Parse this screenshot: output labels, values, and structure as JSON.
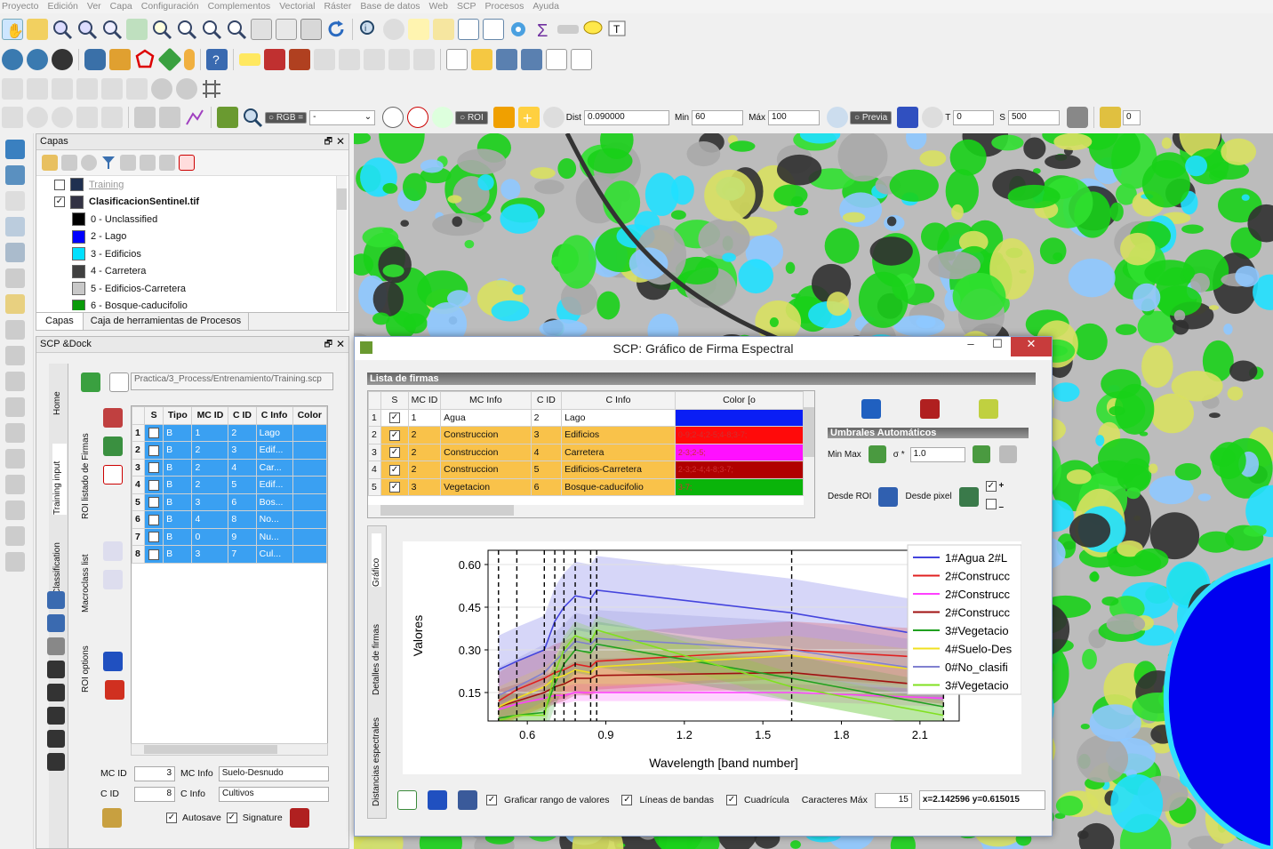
{
  "menu": [
    "Proyecto",
    "Edición",
    "Ver",
    "Capa",
    "Configuración",
    "Complementos",
    "Vectorial",
    "Ráster",
    "Base de datos",
    "Web",
    "SCP",
    "Procesos",
    "Ayuda"
  ],
  "scp_toolbar": {
    "rgb_label": "RGB =",
    "rgb_value": "-",
    "roi_label": "ROI",
    "dist_label": "Dist",
    "dist_value": "0.090000",
    "min_label": "Min",
    "min_value": "60",
    "max_label": "Máx",
    "max_value": "100",
    "previa_label": "Previa",
    "t_label": "T",
    "t_value": "0",
    "s_label": "S",
    "s_value": "500",
    "last_value": "0"
  },
  "layers_panel": {
    "title": "Capas",
    "tabs": [
      "Capas",
      "Caja de herramientas de Procesos"
    ],
    "items": [
      {
        "name": "Training",
        "color": "#203050",
        "indent": 0,
        "grey": true
      },
      {
        "name": "ClasificacionSentinel.tif",
        "color": "#334",
        "indent": 0,
        "bold": true
      },
      {
        "name": "0 - Unclassified",
        "color": "#000000"
      },
      {
        "name": "2 - Lago",
        "color": "#0000ff"
      },
      {
        "name": "3 - Edificios",
        "color": "#00e0ff"
      },
      {
        "name": "4 - Carretera",
        "color": "#404040"
      },
      {
        "name": "5 - Edificios-Carretera",
        "color": "#c8c8c8"
      },
      {
        "name": "6 - Bosque-caducifolio",
        "color": "#0a9a0a"
      }
    ]
  },
  "scp_dock": {
    "title": "SCP &Dock",
    "path": "Practica/3_Process/Entrenamiento/Training.scp",
    "vtabs": [
      "Home",
      "Training input",
      "Classification"
    ],
    "subtabs": [
      "ROI listado de Firmas",
      "Macroclass list",
      "ROI options"
    ],
    "roi_headers": [
      "S",
      "Tipo",
      "MC ID",
      "C ID",
      "C Info",
      "Color"
    ],
    "roi_rows": [
      [
        "1",
        "B",
        "1",
        "2",
        "Lago"
      ],
      [
        "2",
        "B",
        "2",
        "3",
        "Edif..."
      ],
      [
        "3",
        "B",
        "2",
        "4",
        "Car..."
      ],
      [
        "4",
        "B",
        "2",
        "5",
        "Edif..."
      ],
      [
        "5",
        "B",
        "3",
        "6",
        "Bos..."
      ],
      [
        "6",
        "B",
        "4",
        "8",
        "No..."
      ],
      [
        "7",
        "B",
        "0",
        "9",
        "Nu..."
      ],
      [
        "8",
        "B",
        "3",
        "7",
        "Cul..."
      ]
    ],
    "mc_id_label": "MC ID",
    "mc_id": "3",
    "mc_info_label": "MC Info",
    "mc_info": "Suelo-Desnudo",
    "c_id_label": "C ID",
    "c_id": "8",
    "c_info_label": "C Info",
    "c_info": "Cultivos",
    "autosave": "Autosave",
    "signature": "Signature"
  },
  "dialog": {
    "title": "SCP: Gráfico de Firma Espectral",
    "list_title": "Lista de firmas",
    "headers": [
      "S",
      "MC ID",
      "MC Info",
      "C ID",
      "C Info",
      "Color [o"
    ],
    "rows": [
      {
        "n": "1",
        "mcid": "1",
        "mcinfo": "Agua",
        "cid": "2",
        "cinfo": "Lago",
        "color": "#0a1ef5",
        "ctext": "",
        "orange": false
      },
      {
        "n": "2",
        "mcid": "2",
        "mcinfo": "Construccion",
        "cid": "3",
        "cinfo": "Edificios",
        "color": "#ff0a0a",
        "ctext": "0-9;2-4;2-5;4-8;3-7;",
        "orange": true
      },
      {
        "n": "3",
        "mcid": "2",
        "mcinfo": "Construccion",
        "cid": "4",
        "cinfo": "Carretera",
        "color": "#ff10ff",
        "ctext": "2-3;2-5;",
        "orange": true
      },
      {
        "n": "4",
        "mcid": "2",
        "mcinfo": "Construccion",
        "cid": "5",
        "cinfo": "Edificios-Carretera",
        "color": "#b00000",
        "ctext": "2-3;2-4;4-8;3-7;",
        "orange": true
      },
      {
        "n": "5",
        "mcid": "3",
        "mcinfo": "Vegetacion",
        "cid": "6",
        "cinfo": "Bosque-caducifolio",
        "color": "#0ab40a",
        "ctext": "3-7;",
        "orange": true
      }
    ],
    "thresh_title": "Umbrales Automáticos",
    "minmax": "Min Max",
    "sigma": "σ *",
    "sigma_value": "1.0",
    "desde_roi": "Desde ROI",
    "desde_pixel": "Desde pixel",
    "vtabs": [
      "Gráfico",
      "Detalles de firmas",
      "Distancias espectrales"
    ],
    "opt_range": "Graficar rango de valores",
    "opt_lines": "Líneas de bandas",
    "opt_grid": "Cuadrícula",
    "chars_label": "Caracteres Máx",
    "chars_value": "15",
    "coords": "x=2.142596 y=0.615015"
  },
  "chart_data": {
    "type": "line",
    "xlabel": "Wavelength [band number]",
    "ylabel": "Valores",
    "xlim": [
      0.45,
      2.25
    ],
    "ylim": [
      0.05,
      0.65
    ],
    "xticks": [
      "0.6",
      "0.9",
      "1.2",
      "1.5",
      "1.8",
      "2.1"
    ],
    "yticks": [
      "0.15",
      "0.30",
      "0.45",
      "0.60"
    ],
    "band_lines": [
      0.49,
      0.56,
      0.665,
      0.705,
      0.74,
      0.783,
      0.842,
      0.865,
      1.61,
      2.19
    ],
    "x": [
      0.49,
      0.56,
      0.665,
      0.705,
      0.74,
      0.783,
      0.842,
      0.865,
      1.61,
      2.19
    ],
    "series": [
      {
        "name": "1#Agua 2#L",
        "color": "#4444dd",
        "values": [
          0.23,
          0.26,
          0.3,
          0.4,
          0.45,
          0.49,
          0.48,
          0.51,
          0.43,
          0.34
        ]
      },
      {
        "name": "2#Construcc",
        "color": "#e02020",
        "values": [
          0.12,
          0.16,
          0.2,
          0.22,
          0.23,
          0.25,
          0.24,
          0.26,
          0.3,
          0.27
        ]
      },
      {
        "name": "2#Construcc",
        "color": "#ff40ff",
        "values": [
          0.09,
          0.11,
          0.13,
          0.14,
          0.14,
          0.15,
          0.15,
          0.15,
          0.15,
          0.13
        ]
      },
      {
        "name": "2#Construcc",
        "color": "#a01010",
        "values": [
          0.1,
          0.12,
          0.15,
          0.17,
          0.18,
          0.2,
          0.2,
          0.21,
          0.22,
          0.17
        ]
      },
      {
        "name": "3#Vegetacio",
        "color": "#20a020",
        "values": [
          0.06,
          0.07,
          0.08,
          0.18,
          0.25,
          0.3,
          0.29,
          0.32,
          0.2,
          0.1
        ]
      },
      {
        "name": "4#Suelo-Des",
        "color": "#f0e020",
        "values": [
          0.1,
          0.13,
          0.17,
          0.2,
          0.21,
          0.23,
          0.22,
          0.24,
          0.28,
          0.22
        ]
      },
      {
        "name": "0#No_clasifi",
        "color": "#8080d0",
        "values": [
          0.14,
          0.17,
          0.22,
          0.26,
          0.29,
          0.33,
          0.32,
          0.34,
          0.3,
          0.22
        ]
      },
      {
        "name": "3#Vegetacio",
        "color": "#80e020",
        "values": [
          0.05,
          0.07,
          0.07,
          0.22,
          0.3,
          0.35,
          0.33,
          0.37,
          0.17,
          0.07
        ]
      }
    ]
  }
}
